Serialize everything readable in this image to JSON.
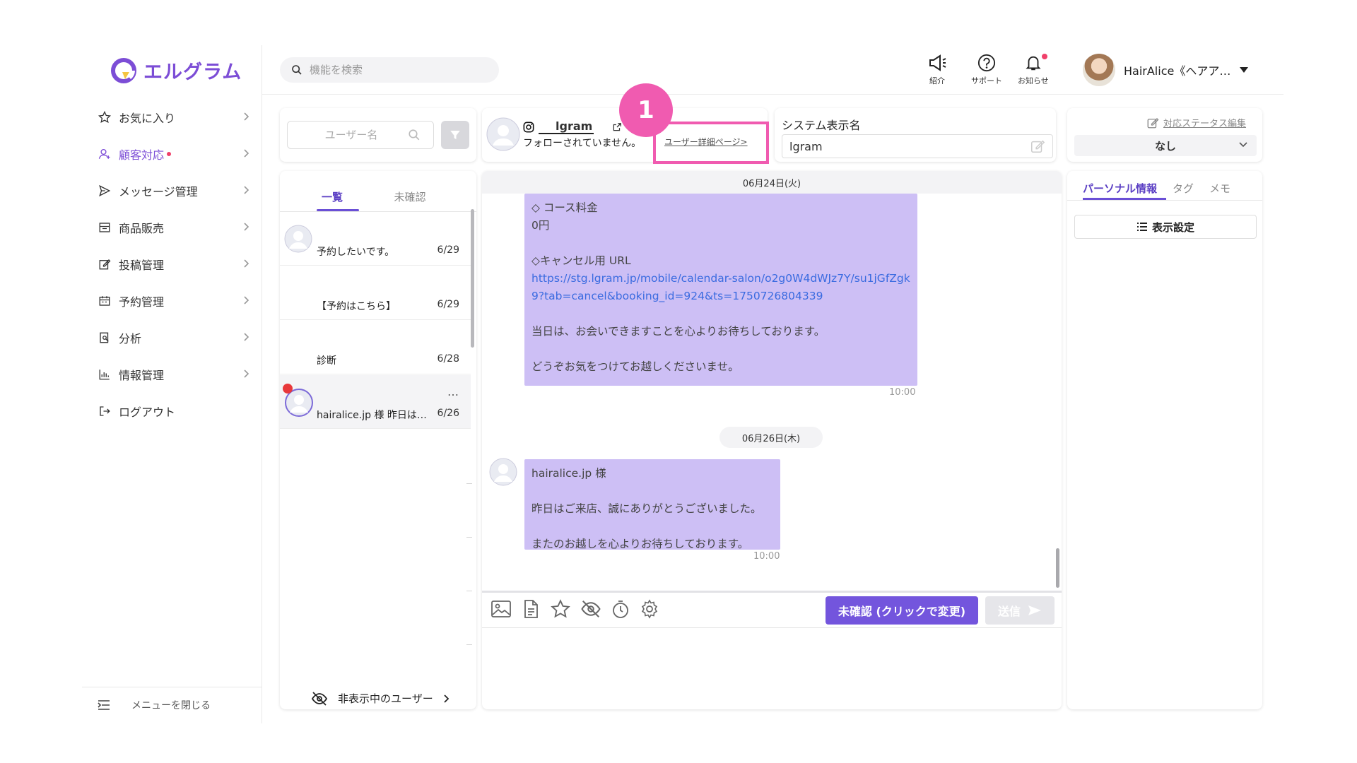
{
  "app": {
    "logo_text": "エルグラム",
    "brand_color": "#7c4dd6"
  },
  "sidebar": {
    "items": [
      {
        "label": "お気に入り",
        "icon": "star-icon"
      },
      {
        "label": "顧客対応",
        "icon": "user-icon",
        "active": true,
        "has_dot": true
      },
      {
        "label": "メッセージ管理",
        "icon": "send-icon"
      },
      {
        "label": "商品販売",
        "icon": "store-icon"
      },
      {
        "label": "投稿管理",
        "icon": "edit-icon"
      },
      {
        "label": "予約管理",
        "icon": "calendar-icon"
      },
      {
        "label": "分析",
        "icon": "report-icon"
      },
      {
        "label": "情報管理",
        "icon": "bar-chart-icon"
      },
      {
        "label": "ログアウト",
        "icon": "logout-icon"
      }
    ],
    "close_menu": "メニューを閉じる"
  },
  "header": {
    "search_placeholder": "機能を検索",
    "icons": [
      {
        "label": "紹介",
        "icon": "megaphone-icon"
      },
      {
        "label": "サポート",
        "icon": "help-icon"
      },
      {
        "label": "お知らせ",
        "icon": "bell-icon",
        "has_dot": true
      }
    ],
    "user_name": "HairAlice《ヘアア…"
  },
  "user_list": {
    "search_placeholder": "ユーザー名",
    "tabs": [
      "一覧",
      "未確認"
    ],
    "items": [
      {
        "text": "予約したいです。",
        "date": "6/29",
        "avatar": true
      },
      {
        "text": "【予約はこちら】",
        "date": "6/29",
        "avatar": false
      },
      {
        "text": "診断",
        "date": "6/28",
        "avatar": false
      },
      {
        "text": "hairalice.jp 様 昨日は…",
        "date": "6/26",
        "avatar": true,
        "unread": true,
        "selected": true,
        "more": "…"
      }
    ],
    "hidden_users": "非表示中のユーザー"
  },
  "user_header": {
    "ig_name": "lgram",
    "follow_status": "フォローされていません。",
    "detail_link": "ユーザー詳細ページ>",
    "annotation_number": "1"
  },
  "system_name": {
    "label": "システム表示名",
    "value": "lgram"
  },
  "status": {
    "edit_label": "対応ステータス編集",
    "value": "なし"
  },
  "chat": {
    "date1": "06月24日(火)",
    "message1": {
      "line1": "◇ コース料金",
      "line2": "0円",
      "line3": "◇キャンセル用 URL",
      "url": "https://stg.lgram.jp/mobile/calendar-salon/o2g0W4dWJz7Y/su1jGfZgk9?tab=cancel&booking_id=924&ts=1750726804339",
      "line4": "当日は、お会いできますことを心よりお待ちしております。",
      "line5": "どうぞお気をつけてお越しくださいませ。",
      "time": "10:00"
    },
    "date2": "06月26日(木)",
    "message2": {
      "line1": "hairalice.jp 様",
      "line2": "昨日はご来店、誠にありがとうございました。",
      "line3": "またのお越しを心よりお待ちしております。",
      "time": "10:00"
    },
    "toolbar_icons": [
      "image-icon",
      "document-icon",
      "star-icon",
      "hide-icon",
      "timer-icon",
      "gear-icon"
    ],
    "unread_button": "未確認 (クリックで変更)",
    "send_button": "送信"
  },
  "info_panel": {
    "tabs": [
      "パーソナル情報",
      "タグ",
      "メモ"
    ],
    "display_settings": "表示設定"
  }
}
